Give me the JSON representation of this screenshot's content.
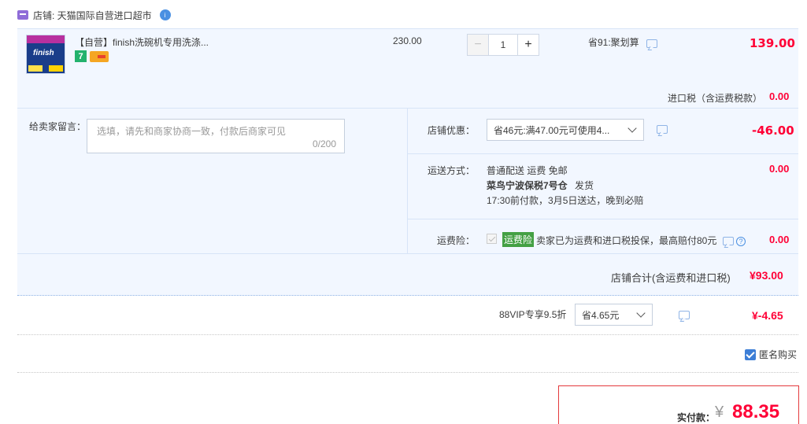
{
  "shop": {
    "label": "店铺: 天猫国际自营进口超市"
  },
  "product": {
    "thumb_text": "finish",
    "title": "【自营】finish洗碗机专用洗涤...",
    "badge_7": "7",
    "unit_price": "230.00",
    "quantity": "1",
    "minus": "−",
    "plus": "+",
    "promo": "省91:聚划算",
    "subtotal": "139.00"
  },
  "tax": {
    "label": "进口税（含运费税款）",
    "value": "0.00"
  },
  "message": {
    "label": "给卖家留言：",
    "placeholder": "选填，请先和商家协商一致，付款后商家可见",
    "count": "0/200"
  },
  "discount": {
    "label": "店铺优惠：",
    "selected": "省46元:满47.00元可使用4...",
    "value": "-46.00"
  },
  "shipping": {
    "label": "运送方式：",
    "line1": "普通配送 运费 免邮",
    "line2": "菜鸟宁波保税7号仓",
    "line2_suffix": "发货",
    "line3": "17:30前付款，3月5日送达，晚到必赔",
    "value": "0.00"
  },
  "insurance": {
    "label": "运费险：",
    "tag": "运费险",
    "text": "卖家已为运费和进口税投保，最高赔付80元",
    "help": "?",
    "value": "0.00"
  },
  "shop_total": {
    "label": "店铺合计(含运费和进口税)",
    "value": "¥93.00"
  },
  "vip": {
    "label": "88VIP专享9.5折",
    "selected": "省4.65元",
    "value": "¥-4.65"
  },
  "anonymous": {
    "label": "匿名购买",
    "checked": true
  },
  "payment": {
    "label": "实付款：",
    "currency": "¥",
    "value": "88.35"
  },
  "colors": {
    "accent_red": "#ff0036",
    "panel_blue": "#f2f7ff",
    "check_blue": "#3d7ed6"
  }
}
